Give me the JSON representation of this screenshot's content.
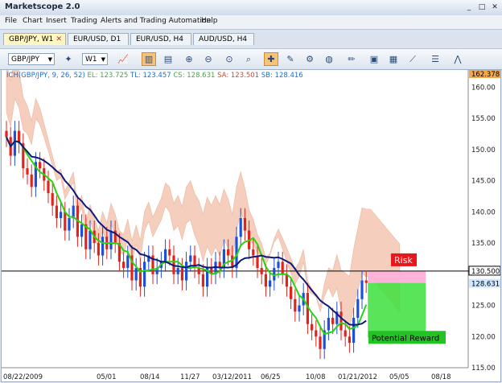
{
  "window": {
    "title": "Marketscope 2.0",
    "controls": [
      "_",
      "□",
      "✕"
    ]
  },
  "menu": [
    "File",
    "Chart",
    "Insert",
    "Trading",
    "Alerts and Trading Automation",
    "Help"
  ],
  "tabs": [
    {
      "label": "GBP/JPY, W1",
      "active": true,
      "close": "✕"
    },
    {
      "label": "EUR/USD, D1",
      "active": false
    },
    {
      "label": "EUR/USD, H4",
      "active": false
    },
    {
      "label": "AUD/USD, H4",
      "active": false
    }
  ],
  "toolbar": {
    "symbol": "GBP/JPY",
    "timeframe": "W1"
  },
  "indicator": {
    "name": "ICH(GBP/JPY, 9, 26, 52)",
    "el": "EL: 123.725",
    "tl": "TL: 123.457",
    "cs": "CS: 128.631",
    "sa": "SA: 123.501",
    "sb": "SB: 128.416"
  },
  "price_axis": {
    "ticks": [
      "160.00",
      "155.00",
      "150.00",
      "145.00",
      "140.00",
      "135.00",
      "125.00",
      "120.00",
      "115.00"
    ],
    "top_marker": "162.378",
    "horizontal_line": "130.500",
    "current": "128.631"
  },
  "time_axis": [
    "08/22/2009",
    "05/01",
    "08/14",
    "11/27",
    "03/12/2011",
    "06/25",
    "10/08",
    "01/21/2012",
    "05/05",
    "08/18"
  ],
  "annotations": {
    "risk": "Risk",
    "reward": "Potential Reward"
  },
  "colors": {
    "bull": "#1f4fd6",
    "bear": "#e0241b",
    "tenkan": "#27d40f",
    "kijun": "#0a1a7a",
    "cloud_up": "#f5c6b2",
    "cloud_dn": "#bfe0f3",
    "risk": "#ffb3d9",
    "reward": "#3ce03c"
  },
  "chart_data": {
    "type": "candlestick",
    "symbol": "GBP/JPY",
    "timeframe": "W1",
    "ylim": [
      115,
      162.378
    ],
    "closes": [
      152,
      149,
      153,
      151,
      147,
      146,
      144,
      148,
      147,
      145,
      143,
      141,
      139,
      140,
      137,
      139,
      141,
      136,
      138,
      134,
      137,
      135,
      133,
      136,
      134,
      137,
      135,
      132,
      131,
      133,
      129,
      131,
      128,
      132,
      133,
      130,
      131,
      132,
      134,
      133,
      130,
      131,
      129,
      132,
      133,
      131,
      130,
      128,
      131,
      130,
      132,
      131,
      134,
      133,
      131,
      136,
      139,
      137,
      134,
      133,
      131,
      130,
      128,
      129,
      131,
      132,
      130,
      128,
      126,
      124,
      125,
      127,
      122,
      121,
      120,
      118,
      121,
      123,
      122,
      124,
      121,
      120,
      119,
      123,
      126,
      129,
      128.6
    ]
  }
}
